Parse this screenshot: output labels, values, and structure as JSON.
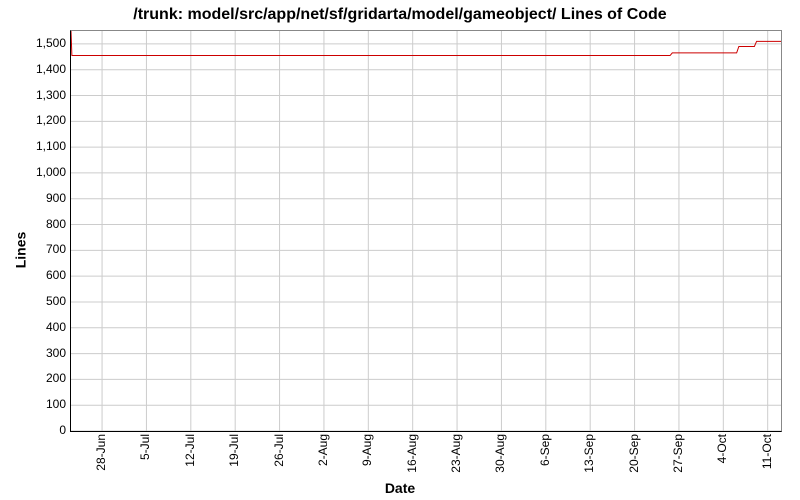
{
  "chart_data": {
    "type": "line",
    "title": "/trunk: model/src/app/net/sf/gridarta/model/gameobject/ Lines of Code",
    "xlabel": "Date",
    "ylabel": "Lines",
    "ylim": [
      0,
      1550
    ],
    "yticks": [
      0,
      100,
      200,
      300,
      400,
      500,
      600,
      700,
      800,
      900,
      1000,
      1100,
      1200,
      1300,
      1400,
      1500
    ],
    "ytick_labels": [
      "0",
      "100",
      "200",
      "300",
      "400",
      "500",
      "600",
      "700",
      "800",
      "900",
      "1,000",
      "1,100",
      "1,200",
      "1,300",
      "1,400",
      "1,500"
    ],
    "xticks": [
      1,
      2,
      3,
      4,
      5,
      6,
      7,
      8,
      9,
      10,
      11,
      12,
      13,
      14,
      15,
      16
    ],
    "xtick_labels": [
      "28-Jun",
      "5-Jul",
      "12-Jul",
      "19-Jul",
      "26-Jul",
      "2-Aug",
      "9-Aug",
      "16-Aug",
      "23-Aug",
      "30-Aug",
      "6-Sep",
      "13-Sep",
      "20-Sep",
      "27-Sep",
      "4-Oct",
      "11-Oct"
    ],
    "x_range": [
      0.3,
      16.3
    ],
    "series": [
      {
        "name": "Lines of Code",
        "color": "#cc0000",
        "points": [
          {
            "x": 0.3,
            "y": 1570
          },
          {
            "x": 0.32,
            "y": 1455
          },
          {
            "x": 13.8,
            "y": 1455
          },
          {
            "x": 13.85,
            "y": 1465
          },
          {
            "x": 15.3,
            "y": 1465
          },
          {
            "x": 15.35,
            "y": 1490
          },
          {
            "x": 15.7,
            "y": 1490
          },
          {
            "x": 15.75,
            "y": 1510
          },
          {
            "x": 16.3,
            "y": 1510
          }
        ]
      }
    ]
  }
}
